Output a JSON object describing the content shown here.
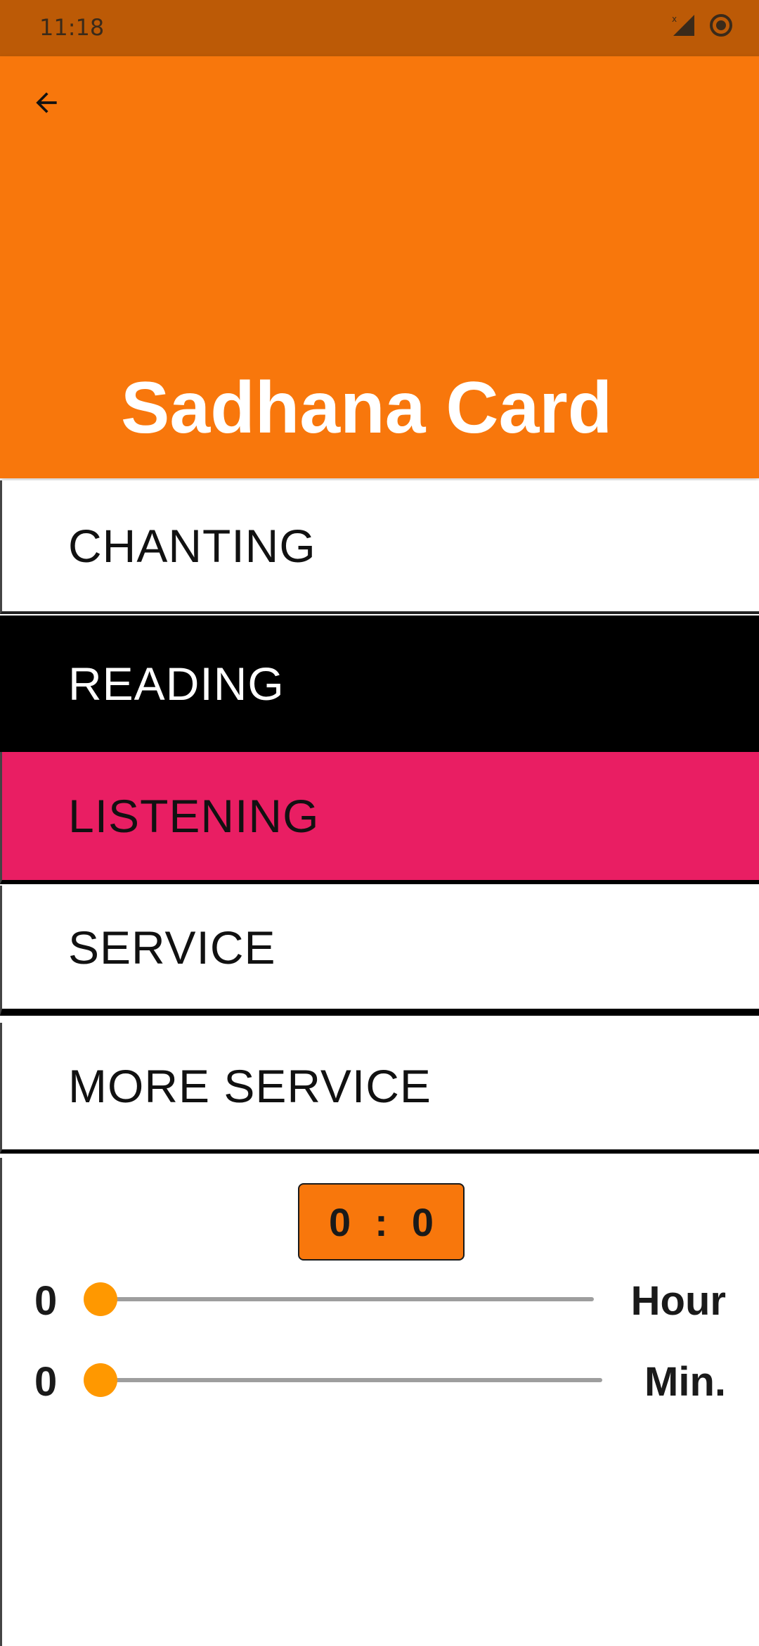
{
  "status_bar": {
    "time": "11:18",
    "icons": [
      "signal-icon",
      "sync-icon"
    ]
  },
  "header": {
    "title": "Sadhana Card",
    "back_icon": "arrow-back-icon",
    "background_color": "#F8770C"
  },
  "tabs": [
    {
      "label": "CHANTING",
      "state": "default"
    },
    {
      "label": "READING",
      "state": "selected"
    },
    {
      "label": "LISTENING",
      "state": "highlighted"
    },
    {
      "label": "SERVICE",
      "state": "default"
    },
    {
      "label": "MORE SERVICE",
      "state": "default"
    }
  ],
  "timer": {
    "hours": "0",
    "separator": ":",
    "minutes": "0"
  },
  "sliders": {
    "hour": {
      "value": "0",
      "unit": "Hour",
      "level": 0
    },
    "minute": {
      "value": "0",
      "unit": "Min.",
      "level": 0
    }
  },
  "colors": {
    "status_bar": "#BC5A06",
    "accent": "#F8770C",
    "slider_thumb": "#FF9800",
    "listening_tab": "#E91E63",
    "reading_tab": "#000000"
  }
}
